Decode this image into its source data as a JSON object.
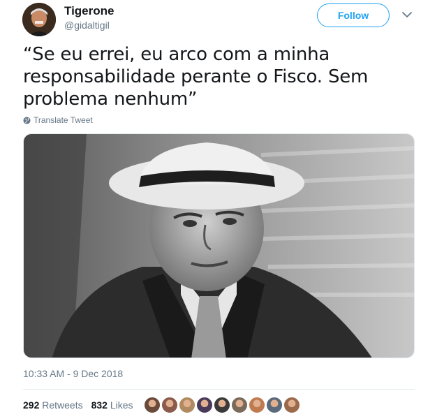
{
  "author": {
    "display_name": "Tigerone",
    "handle": "@gidaltigil"
  },
  "follow_button": {
    "label": "Follow"
  },
  "tweet": {
    "text": "“Se eu errei, eu arco com a minha responsabilidade perante o Fisco. Sem problema nenhum”",
    "translate_label": "Translate Tweet",
    "timestamp": "10:33 AM - 9 Dec 2018"
  },
  "stats": {
    "retweets_count": "292",
    "retweets_label": "Retweets",
    "likes_count": "832",
    "likes_label": "Likes"
  },
  "likers": [
    {
      "color": "#6a4a3a"
    },
    {
      "color": "#8a5a4a"
    },
    {
      "color": "#b08a60"
    },
    {
      "color": "#4a3a5a"
    },
    {
      "color": "#3a3a3a"
    },
    {
      "color": "#7a6a5a"
    },
    {
      "color": "#c07a50"
    },
    {
      "color": "#5a6a7a"
    },
    {
      "color": "#9a6a4a"
    }
  ]
}
